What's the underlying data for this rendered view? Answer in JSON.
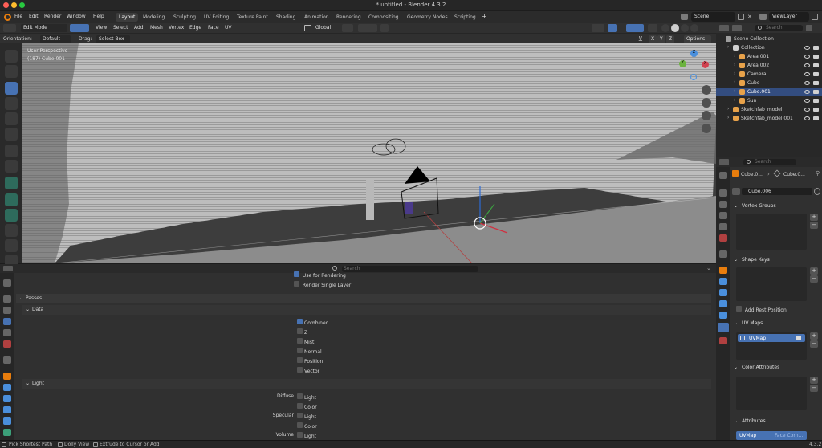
{
  "window": {
    "title": "* untitled - Blender 4.3.2"
  },
  "menubar": {
    "menus": [
      "File",
      "Edit",
      "Render",
      "Window",
      "Help"
    ],
    "workspaces": [
      "Layout",
      "Modeling",
      "Sculpting",
      "UV Editing",
      "Texture Paint",
      "Shading",
      "Animation",
      "Rendering",
      "Compositing",
      "Geometry Nodes",
      "Scripting"
    ],
    "add_workspace": "+",
    "scene": "Scene",
    "view_layer": "ViewLayer"
  },
  "viewport_header": {
    "mode": "Edit Mode",
    "menus": [
      "View",
      "Select",
      "Add",
      "Mesh",
      "Vertex",
      "Edge",
      "Face",
      "UV"
    ],
    "transform_orientation": "Global",
    "axes": [
      "X",
      "Y",
      "Z"
    ],
    "options": "Options",
    "orientation_label": "Orientation:",
    "orientation_value": "Default",
    "drag_label": "Drag:",
    "drag_value": "Select Box"
  },
  "viewport": {
    "view_name": "User Perspective",
    "object_info": "(187) Cube.001",
    "gizmo_axes": [
      "X",
      "Y",
      "Z"
    ]
  },
  "properties_bottom": {
    "search_placeholder": "Search",
    "use_for_rendering": "Use for Rendering",
    "render_single_layer": "Render Single Layer",
    "passes": "Passes",
    "data": "Data",
    "data_passes": [
      {
        "label": "Combined",
        "checked": true
      },
      {
        "label": "Z",
        "checked": false
      },
      {
        "label": "Mist",
        "checked": false
      },
      {
        "label": "Normal",
        "checked": false
      },
      {
        "label": "Position",
        "checked": false
      },
      {
        "label": "Vector",
        "checked": false
      }
    ],
    "light": "Light",
    "diffuse": "Diffuse",
    "specular": "Specular",
    "volume": "Volume",
    "light_opt": "Light",
    "color_opt": "Color"
  },
  "outliner": {
    "search_placeholder": "Search",
    "root": "Scene Collection",
    "items": [
      {
        "label": "Collection",
        "depth": 1,
        "icon_color": "#cfcfcf",
        "selected": false
      },
      {
        "label": "Area.001",
        "depth": 2,
        "icon_color": "#e8a24a",
        "selected": false
      },
      {
        "label": "Area.002",
        "depth": 2,
        "icon_color": "#e8a24a",
        "selected": false
      },
      {
        "label": "Camera",
        "depth": 2,
        "icon_color": "#e8a24a",
        "selected": false
      },
      {
        "label": "Cube",
        "depth": 2,
        "icon_color": "#e8a24a",
        "selected": false
      },
      {
        "label": "Cube.001",
        "depth": 2,
        "icon_color": "#e8a24a",
        "selected": true
      },
      {
        "label": "Sun",
        "depth": 2,
        "icon_color": "#e8a24a",
        "selected": false
      },
      {
        "label": "Sketchfab_model",
        "depth": 1,
        "icon_color": "#e8a24a",
        "selected": false
      },
      {
        "label": "Sketchfab_model.001",
        "depth": 1,
        "icon_color": "#e8a24a",
        "selected": false
      }
    ]
  },
  "properties_right": {
    "search_placeholder": "Search",
    "breadcrumb": [
      "Cube.0...",
      "Cube.0..."
    ],
    "mesh_name": "Cube.006",
    "vertex_groups": "Vertex Groups",
    "shape_keys": "Shape Keys",
    "add_rest_position": "Add Rest Position",
    "uv_maps": "UV Maps",
    "uv_map_item": "UVMap",
    "color_attributes": "Color Attributes",
    "attributes": "Attributes",
    "attr_name": "UVMap",
    "attr_domain": "Face Corn..."
  },
  "statusbar": {
    "hints": [
      "Pick Shortest Path",
      "Dolly View",
      "Extrude to Cursor or Add"
    ],
    "version": "4.3.2"
  },
  "colors": {
    "accent": "#4772b3",
    "viewport_bg": "#3d3d3d",
    "panel": "#303030"
  }
}
